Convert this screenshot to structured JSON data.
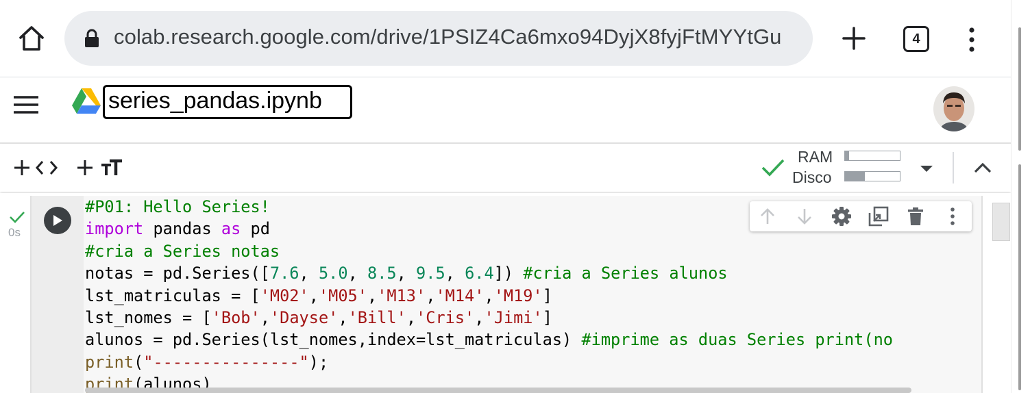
{
  "browser": {
    "url": "colab.research.google.com/drive/1PSIZ4Ca6mxo94DyjX8fyjFtMYYtGu",
    "tab_count": "4"
  },
  "colab": {
    "notebook_title": "series_pandas.ipynb"
  },
  "toolbar": {
    "ram_label": "RAM",
    "disk_label": "Disco",
    "ram_usage": 0.07,
    "disk_usage": 0.36,
    "status_color": "#34a853"
  },
  "cell": {
    "exec_time": "0s",
    "code_lines": [
      [
        {
          "t": "#P01: Hello Series!",
          "c": "cm"
        }
      ],
      [
        {
          "t": "import",
          "c": "kw"
        },
        {
          "t": " pandas "
        },
        {
          "t": "as",
          "c": "kw"
        },
        {
          "t": " pd"
        }
      ],
      [
        {
          "t": "#cria a Series notas",
          "c": "cm"
        }
      ],
      [
        {
          "t": "notas = pd.Series(["
        },
        {
          "t": "7.6",
          "c": "num"
        },
        {
          "t": ", "
        },
        {
          "t": "5.0",
          "c": "num"
        },
        {
          "t": ", "
        },
        {
          "t": "8.5",
          "c": "num"
        },
        {
          "t": ", "
        },
        {
          "t": "9.5",
          "c": "num"
        },
        {
          "t": ", "
        },
        {
          "t": "6.4",
          "c": "num"
        },
        {
          "t": "]) "
        },
        {
          "t": "#cria a Series alunos",
          "c": "cm"
        }
      ],
      [
        {
          "t": "lst_matriculas = ["
        },
        {
          "t": "'M02'",
          "c": "str"
        },
        {
          "t": ","
        },
        {
          "t": "'M05'",
          "c": "str"
        },
        {
          "t": ","
        },
        {
          "t": "'M13'",
          "c": "str"
        },
        {
          "t": ","
        },
        {
          "t": "'M14'",
          "c": "str"
        },
        {
          "t": ","
        },
        {
          "t": "'M19'",
          "c": "str"
        },
        {
          "t": "]"
        }
      ],
      [
        {
          "t": "lst_nomes = ["
        },
        {
          "t": "'Bob'",
          "c": "str"
        },
        {
          "t": ","
        },
        {
          "t": "'Dayse'",
          "c": "str"
        },
        {
          "t": ","
        },
        {
          "t": "'Bill'",
          "c": "str"
        },
        {
          "t": ","
        },
        {
          "t": "'Cris'",
          "c": "str"
        },
        {
          "t": ","
        },
        {
          "t": "'Jimi'",
          "c": "str"
        },
        {
          "t": "]"
        }
      ],
      [
        {
          "t": "alunos = pd.Series(lst_nomes,index=lst_matriculas) "
        },
        {
          "t": "#imprime as duas Series print(no",
          "c": "cm"
        }
      ],
      [
        {
          "t": "print",
          "c": "fn"
        },
        {
          "t": "("
        },
        {
          "t": "\"---------------\"",
          "c": "str"
        },
        {
          "t": ");"
        }
      ],
      [
        {
          "t": "print",
          "c": "fn"
        },
        {
          "t": "(alunos)"
        }
      ]
    ]
  },
  "icons": {
    "home": "home-icon",
    "lock": "lock-icon",
    "new_tab": "plus-icon",
    "menu": "more-vert-icon",
    "hamburger": "hamburger-icon",
    "drive": "google-drive-icon",
    "add_code": "add-code-icon",
    "add_text": "add-text-icon",
    "check": "check-icon",
    "dropdown": "chevron-down-icon",
    "collapse": "chevron-up-icon",
    "run": "play-icon",
    "move_up": "arrow-up-icon",
    "move_down": "arrow-down-icon",
    "settings": "gear-icon",
    "mirror": "mirror-cell-icon",
    "delete": "trash-icon",
    "more": "more-vert-icon"
  }
}
